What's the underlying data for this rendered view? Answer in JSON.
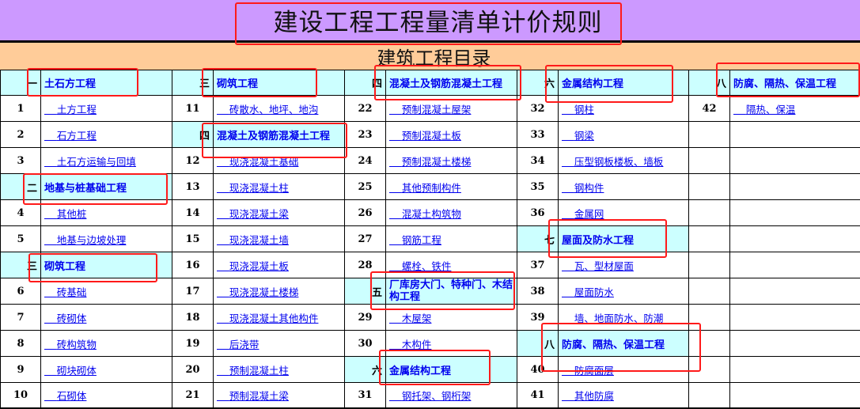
{
  "header": {
    "title": "建设工程工程量清单计价规则",
    "subtitle": "建筑工程目录"
  },
  "colors": {
    "title_band": "#cc99ff",
    "subtitle_band": "#ffcc99",
    "section_bg": "#ccffff",
    "link": "#0000ee",
    "annotation": "#ff1a1a"
  },
  "rows": [
    [
      {
        "type": "sec",
        "num": "一",
        "label": "土石方工程"
      },
      {
        "type": "sec",
        "num": "三",
        "label": "砌筑工程"
      },
      {
        "type": "sec",
        "num": "四",
        "label": "混凝土及钢筋混凝土工程"
      },
      {
        "type": "sec",
        "num": "六",
        "label": "金属结构工程"
      },
      {
        "type": "sec",
        "num": "八",
        "label": "防腐、隔热、保温工程"
      }
    ],
    [
      {
        "type": "item",
        "num": "1",
        "label": "土方工程"
      },
      {
        "type": "item",
        "num": "11",
        "label": "砖散水、地坪、地沟"
      },
      {
        "type": "item",
        "num": "22",
        "label": "预制混凝土屋架"
      },
      {
        "type": "item",
        "num": "32",
        "label": "钢柱"
      },
      {
        "type": "item",
        "num": "42",
        "label": "隔热、保温"
      }
    ],
    [
      {
        "type": "item",
        "num": "2",
        "label": "石方工程"
      },
      {
        "type": "sec",
        "num": "四",
        "label": "混凝土及钢筋混凝土工程"
      },
      {
        "type": "item",
        "num": "23",
        "label": "预制混凝土板"
      },
      {
        "type": "item",
        "num": "33",
        "label": "钢梁"
      },
      {
        "type": "empty"
      }
    ],
    [
      {
        "type": "item",
        "num": "3",
        "label": "土石方运输与回填"
      },
      {
        "type": "item",
        "num": "12",
        "label": "现浇混凝土基础"
      },
      {
        "type": "item",
        "num": "24",
        "label": "预制混凝土楼梯"
      },
      {
        "type": "item",
        "num": "34",
        "label": "压型钢板楼板、墙板"
      },
      {
        "type": "empty"
      }
    ],
    [
      {
        "type": "sec",
        "num": "二",
        "label": "地基与桩基础工程"
      },
      {
        "type": "item",
        "num": "13",
        "label": "现浇混凝土柱"
      },
      {
        "type": "item",
        "num": "25",
        "label": "其他预制构件"
      },
      {
        "type": "item",
        "num": "35",
        "label": "钢构件"
      },
      {
        "type": "empty"
      }
    ],
    [
      {
        "type": "item",
        "num": "4",
        "label": "其他桩"
      },
      {
        "type": "item",
        "num": "14",
        "label": "现浇混凝土梁"
      },
      {
        "type": "item",
        "num": "26",
        "label": "混凝土构筑物"
      },
      {
        "type": "item",
        "num": "36",
        "label": "金属网"
      },
      {
        "type": "empty"
      }
    ],
    [
      {
        "type": "item",
        "num": "5",
        "label": "地基与边坡处理"
      },
      {
        "type": "item",
        "num": "15",
        "label": "现浇混凝土墙"
      },
      {
        "type": "item",
        "num": "27",
        "label": "钢筋工程"
      },
      {
        "type": "sec",
        "num": "七",
        "label": "屋面及防水工程"
      },
      {
        "type": "empty"
      }
    ],
    [
      {
        "type": "sec",
        "num": "三",
        "label": "砌筑工程"
      },
      {
        "type": "item",
        "num": "16",
        "label": "现浇混凝土板"
      },
      {
        "type": "item",
        "num": "28",
        "label": "螺栓、铁件"
      },
      {
        "type": "item",
        "num": "37",
        "label": "瓦、型材屋面"
      },
      {
        "type": "empty"
      }
    ],
    [
      {
        "type": "item",
        "num": "6",
        "label": "砖基础"
      },
      {
        "type": "item",
        "num": "17",
        "label": "现浇混凝土楼梯"
      },
      {
        "type": "sec",
        "num": "五",
        "label": "厂库房大门、特种门、木结构工程",
        "wrap": true
      },
      {
        "type": "item",
        "num": "38",
        "label": "屋面防水"
      },
      {
        "type": "empty"
      }
    ],
    [
      {
        "type": "item",
        "num": "7",
        "label": "砖砌体"
      },
      {
        "type": "item",
        "num": "18",
        "label": "现浇混凝土其他构件"
      },
      {
        "type": "item",
        "num": "29",
        "label": "木屋架"
      },
      {
        "type": "item",
        "num": "39",
        "label": "墙、地面防水、防潮"
      },
      {
        "type": "empty"
      }
    ],
    [
      {
        "type": "item",
        "num": "8",
        "label": "砖构筑物"
      },
      {
        "type": "item",
        "num": "19",
        "label": "后浇带"
      },
      {
        "type": "item",
        "num": "30",
        "label": "木构件"
      },
      {
        "type": "sec",
        "num": "八",
        "label": "防腐、隔热、保温工程"
      },
      {
        "type": "empty"
      }
    ],
    [
      {
        "type": "item",
        "num": "9",
        "label": "砌块砌体"
      },
      {
        "type": "item",
        "num": "20",
        "label": "预制混凝土柱"
      },
      {
        "type": "sec",
        "num": "六",
        "label": "金属结构工程"
      },
      {
        "type": "item",
        "num": "40",
        "label": "防腐面层"
      },
      {
        "type": "empty"
      }
    ],
    [
      {
        "type": "item",
        "num": "10",
        "label": "石砌体"
      },
      {
        "type": "item",
        "num": "21",
        "label": "预制混凝土梁"
      },
      {
        "type": "item",
        "num": "31",
        "label": "钢托架、钢桁架"
      },
      {
        "type": "item",
        "num": "41",
        "label": "其他防腐"
      },
      {
        "type": "empty"
      }
    ]
  ]
}
